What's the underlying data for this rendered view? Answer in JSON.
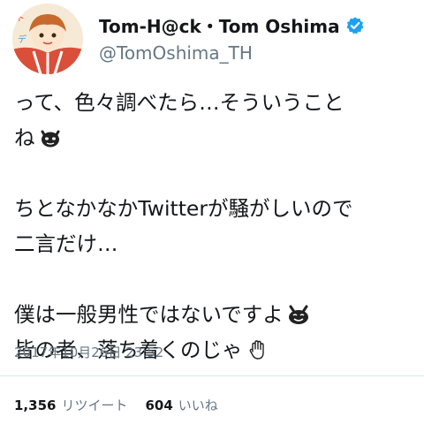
{
  "user": {
    "display_name": "Tom-H@ck・Tom Oshima",
    "handle": "@TomOshima_TH",
    "verified": true,
    "verified_color": "#1da1f2"
  },
  "tweet": {
    "lines": [
      {
        "text": "って、色々調べたら…そういうこと",
        "icon": ""
      },
      {
        "text": "ね",
        "icon": "devil-face-icon"
      },
      {
        "text": "",
        "icon": ""
      },
      {
        "text": "ちとなかなかTwitterが騒がしいので",
        "icon": ""
      },
      {
        "text": "二言だけ…",
        "icon": ""
      },
      {
        "text": "",
        "icon": ""
      },
      {
        "text": "僕は一般男性ではないですよ",
        "icon": "smiling-devil-icon"
      },
      {
        "text": "皆の者、落ち着くのじゃ",
        "icon": "raised-hand-icon"
      }
    ],
    "timestamp": "2017年10月26日 23:52"
  },
  "stats": {
    "retweets_count": "1,356",
    "retweets_label": "リツイート",
    "likes_count": "604",
    "likes_label": "いいね"
  }
}
